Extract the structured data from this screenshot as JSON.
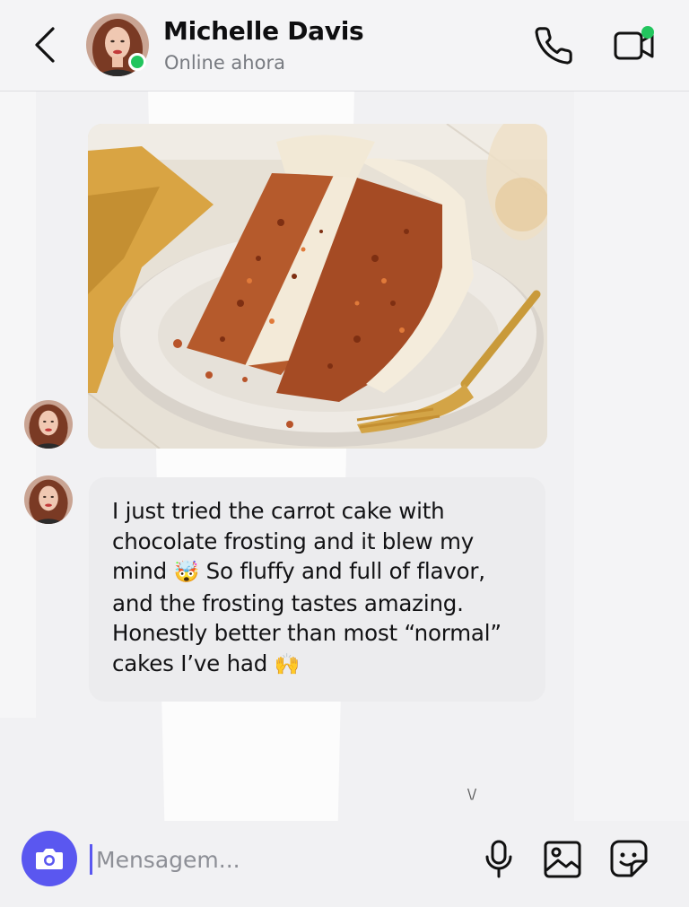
{
  "header": {
    "contact_name": "Michelle Davis",
    "status": "Online ahora",
    "back_icon": "chevron-left-icon",
    "call_icon": "phone-icon",
    "video_icon": "video-camera-icon"
  },
  "conversation": {
    "messages": [
      {
        "type": "image",
        "sender": "Michelle Davis",
        "image": "carrot-cake-slice-photo"
      },
      {
        "type": "text",
        "sender": "Michelle Davis",
        "text_parts": [
          "I just tried the carrot cake with chocolate frosting and it blew my mind ",
          "🤯",
          " So fluffy and full of flavor, and the frosting tastes amazing. Honestly better than most “normal” cakes I’ve had ",
          "🙌"
        ]
      }
    ]
  },
  "composer": {
    "placeholder": "Mensagem...",
    "value": "",
    "camera_icon": "camera-icon",
    "mic_icon": "microphone-icon",
    "gallery_icon": "image-icon",
    "sticker_icon": "sticker-icon"
  },
  "colors": {
    "accent": "#5a57f0",
    "online": "#22c55e",
    "bubble": "#ececee",
    "background": "#f1f1f3"
  }
}
